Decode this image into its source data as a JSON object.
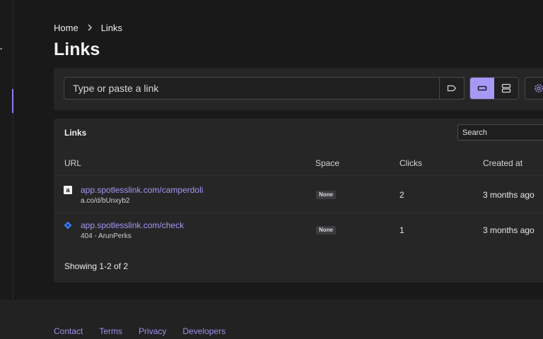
{
  "breadcrumb": {
    "home": "Home",
    "current": "Links"
  },
  "page": {
    "title": "Links"
  },
  "link_input": {
    "placeholder": "Type or paste a link"
  },
  "table": {
    "title": "Links",
    "search_placeholder": "Search",
    "columns": {
      "url": "URL",
      "space": "Space",
      "clicks": "Clicks",
      "created": "Created at"
    },
    "rows": [
      {
        "favicon": "amazon-icon",
        "url": "app.spotlesslink.com/camperdoli",
        "destination": "a.co/d/bUnxyb2",
        "space": "None",
        "clicks": "2",
        "created": "3 months ago"
      },
      {
        "favicon": "diamond-icon",
        "url": "app.spotlesslink.com/check",
        "destination": "404 - ArunPerks",
        "space": "None",
        "clicks": "1",
        "created": "3 months ago"
      }
    ],
    "showing": "Showing 1-2 of 2"
  },
  "footer": {
    "links": [
      "Contact",
      "Terms",
      "Privacy",
      "Developers"
    ]
  },
  "colors": {
    "accent": "#a497f3",
    "background": "#19191a",
    "card": "#262627"
  }
}
